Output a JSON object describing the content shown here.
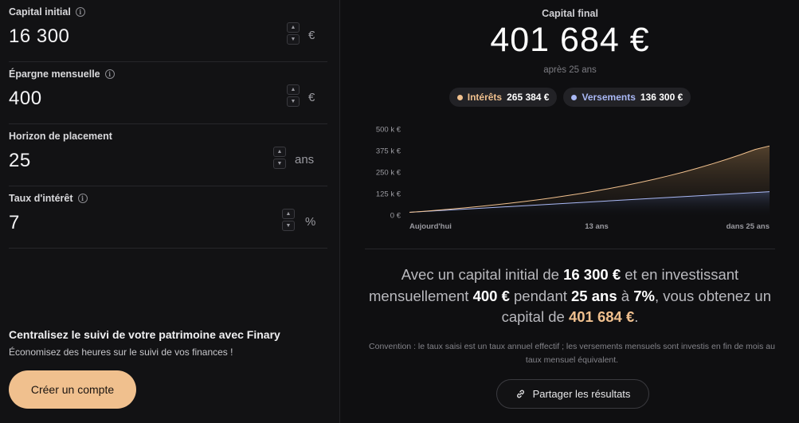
{
  "form": {
    "fields": [
      {
        "label": "Capital initial",
        "value": "16 300",
        "unit": "€",
        "has_info": true
      },
      {
        "label": "Épargne mensuelle",
        "value": "400",
        "unit": "€",
        "has_info": true
      },
      {
        "label": "Horizon de placement",
        "value": "25",
        "unit": "ans",
        "has_info": false
      },
      {
        "label": "Taux d'intérêt",
        "value": "7",
        "unit": "%",
        "has_info": true
      }
    ],
    "stepper_up": "▲",
    "stepper_down": "▼",
    "info_glyph": "i"
  },
  "promo": {
    "title": "Centralisez le suivi de votre patrimoine avec Finary",
    "subtitle": "Économisez des heures sur le suivi de vos finances !",
    "cta_label": "Créer un compte"
  },
  "result": {
    "label": "Capital final",
    "value": "401 684 €",
    "sub": "après 25 ans",
    "pills": [
      {
        "name": "Intérêts",
        "value": "265 384 €",
        "color": "#f0c08e"
      },
      {
        "name": "Versements",
        "value": "136 300 €",
        "color": "#a9b8f5"
      }
    ]
  },
  "chart_data": {
    "type": "area",
    "x_tick_labels": [
      "Aujourd'hui",
      "13 ans",
      "dans 25 ans"
    ],
    "y_tick_labels": [
      "500 k €",
      "375 k €",
      "250 k €",
      "125 k €",
      "0 €"
    ],
    "ylim": [
      0,
      500000
    ],
    "xlim": [
      0,
      25
    ],
    "series": [
      {
        "name": "Intérêts",
        "color": "#f0c08e",
        "x": [
          0,
          1,
          2,
          3,
          4,
          5,
          6,
          7,
          8,
          9,
          10,
          11,
          12,
          13,
          14,
          15,
          16,
          17,
          18,
          19,
          20,
          21,
          22,
          23,
          24,
          25
        ],
        "values": [
          16300,
          22400,
          28900,
          35900,
          43400,
          51500,
          60100,
          69400,
          79300,
          90000,
          101400,
          113700,
          126900,
          141000,
          156100,
          172300,
          189700,
          208300,
          228300,
          249700,
          272600,
          297100,
          323400,
          351600,
          381700,
          401684
        ]
      },
      {
        "name": "Versements",
        "color": "#a9b8f5",
        "x": [
          0,
          25
        ],
        "values": [
          16300,
          136300
        ]
      }
    ],
    "grid": false,
    "legend": "top-center"
  },
  "summary": {
    "p1": "Avec un capital initial de ",
    "b1": "16 300 €",
    "p2": " et en investissant mensuellement ",
    "b2": "400 €",
    "p3": " pendant ",
    "b3": "25 ans",
    "p4": " à ",
    "b4": "7%",
    "p5": ", vous obtenez un capital de ",
    "b5": "401 684 €",
    "p6": "."
  },
  "convention": "Convention : le taux saisi est un taux annuel effectif ; les versements mensuels sont investis en fin de mois au taux mensuel équivalent.",
  "share_label": "Partager les résultats"
}
